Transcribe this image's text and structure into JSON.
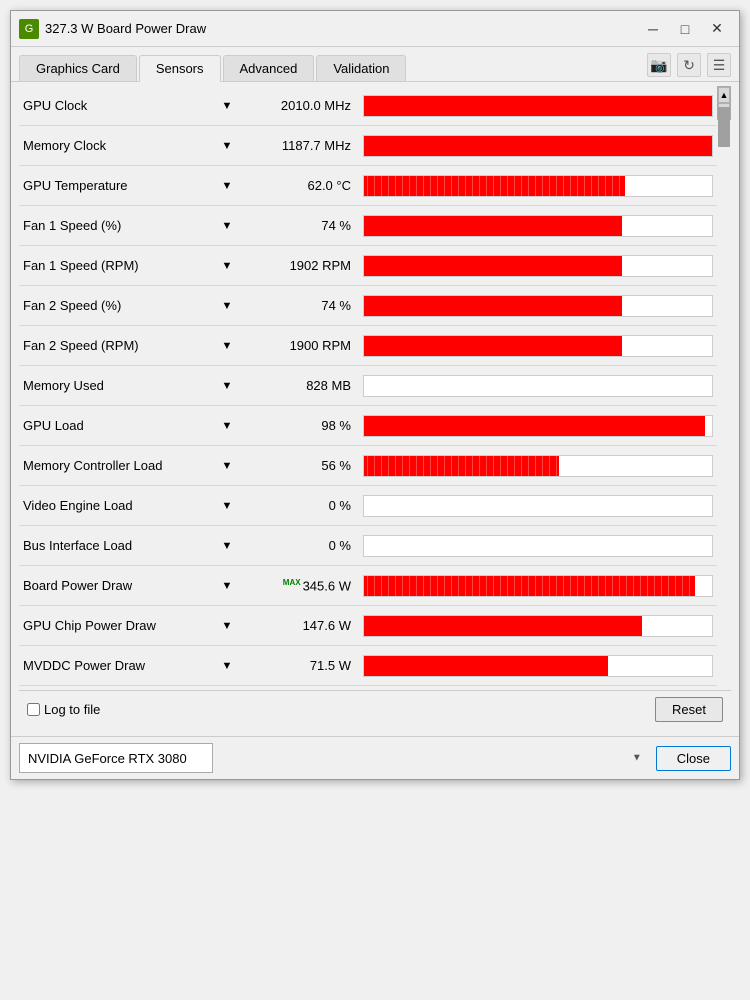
{
  "window": {
    "title": "327.3 W Board Power Draw",
    "icon_label": "G"
  },
  "titlebar": {
    "minimize_label": "─",
    "maximize_label": "□",
    "close_label": "✕"
  },
  "tabs": [
    {
      "id": "graphics-card",
      "label": "Graphics Card",
      "active": false
    },
    {
      "id": "sensors",
      "label": "Sensors",
      "active": true
    },
    {
      "id": "advanced",
      "label": "Advanced",
      "active": false
    },
    {
      "id": "validation",
      "label": "Validation",
      "active": false
    }
  ],
  "tab_icons": {
    "camera": "📷",
    "refresh": "↻",
    "menu": "☰"
  },
  "sensors": [
    {
      "name": "GPU Clock",
      "value": "2010.0 MHz",
      "bar_pct": 100,
      "bar_type": "solid",
      "has_max": false
    },
    {
      "name": "Memory Clock",
      "value": "1187.7 MHz",
      "bar_pct": 100,
      "bar_type": "solid",
      "has_max": false
    },
    {
      "name": "GPU Temperature",
      "value": "62.0 °C",
      "bar_pct": 75,
      "bar_type": "noisy",
      "has_max": false
    },
    {
      "name": "Fan 1 Speed (%)",
      "value": "74 %",
      "bar_pct": 74,
      "bar_type": "solid",
      "has_max": false
    },
    {
      "name": "Fan 1 Speed (RPM)",
      "value": "1902 RPM",
      "bar_pct": 74,
      "bar_type": "solid",
      "has_max": false
    },
    {
      "name": "Fan 2 Speed (%)",
      "value": "74 %",
      "bar_pct": 74,
      "bar_type": "solid",
      "has_max": false
    },
    {
      "name": "Fan 2 Speed (RPM)",
      "value": "1900 RPM",
      "bar_pct": 74,
      "bar_type": "solid",
      "has_max": false
    },
    {
      "name": "Memory Used",
      "value": "828 MB",
      "bar_pct": 6,
      "bar_type": "empty",
      "has_max": false
    },
    {
      "name": "GPU Load",
      "value": "98 %",
      "bar_pct": 98,
      "bar_type": "solid",
      "has_max": false
    },
    {
      "name": "Memory Controller Load",
      "value": "56 %",
      "bar_pct": 56,
      "bar_type": "noisy",
      "has_max": false
    },
    {
      "name": "Video Engine Load",
      "value": "0 %",
      "bar_pct": 0,
      "bar_type": "empty",
      "has_max": false
    },
    {
      "name": "Bus Interface Load",
      "value": "0 %",
      "bar_pct": 0,
      "bar_type": "empty",
      "has_max": false
    },
    {
      "name": "Board Power Draw",
      "value": "345.6 W",
      "bar_pct": 95,
      "bar_type": "noisy",
      "has_max": true
    },
    {
      "name": "GPU Chip Power Draw",
      "value": "147.6 W",
      "bar_pct": 80,
      "bar_type": "solid",
      "has_max": false
    },
    {
      "name": "MVDDC Power Draw",
      "value": "71.5 W",
      "bar_pct": 70,
      "bar_type": "solid",
      "has_max": false
    }
  ],
  "bottom": {
    "log_label": "Log to file",
    "reset_label": "Reset"
  },
  "footer": {
    "gpu_name": "NVIDIA GeForce RTX 3080",
    "close_label": "Close"
  }
}
